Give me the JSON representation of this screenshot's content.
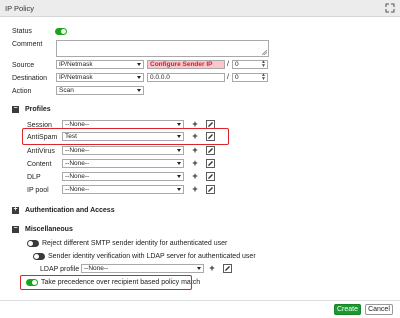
{
  "window": {
    "title": "IP Policy"
  },
  "form": {
    "status_label": "Status",
    "comment_label": "Comment",
    "source": {
      "label": "Source",
      "type": "IP/Netmask",
      "value": "Configure Sender IP",
      "prefix": "0",
      "slash": "/"
    },
    "destination": {
      "label": "Destination",
      "type": "IP/Netmask",
      "value": "0.0.0.0",
      "prefix": "0",
      "slash": "/"
    },
    "action": {
      "label": "Action",
      "value": "Scan"
    }
  },
  "profiles": {
    "section_title": "Profiles",
    "rows": [
      {
        "label": "Session",
        "value": "--None--"
      },
      {
        "label": "AntiSpam",
        "value": "Test"
      },
      {
        "label": "AntiVirus",
        "value": "--None--"
      },
      {
        "label": "Content",
        "value": "--None--"
      },
      {
        "label": "DLP",
        "value": "--None--"
      },
      {
        "label": "IP pool",
        "value": "--None--"
      }
    ]
  },
  "auth_section": {
    "title": "Authentication and Access"
  },
  "misc": {
    "title": "Miscellaneous",
    "reject_smtp": "Reject different SMTP sender identity for authenticated user",
    "sender_ldap": "Sender identity verification with LDAP server for authenticated user",
    "ldap_profile_label": "LDAP profile",
    "ldap_profile_value": "--None--",
    "precedence": "Take precedence over recipient based policy match"
  },
  "footer": {
    "create_label": "Create",
    "cancel_label": "Cancel"
  },
  "colors": {
    "accent_green": "#19a519",
    "highlight_red": "#d9262d",
    "pink_field": "#f8c8cc"
  },
  "icons": {
    "expand": "expand-icon",
    "add": "plus-icon",
    "edit": "edit-icon",
    "collapse": "minus-square-icon",
    "expand_section": "plus-square-icon"
  }
}
